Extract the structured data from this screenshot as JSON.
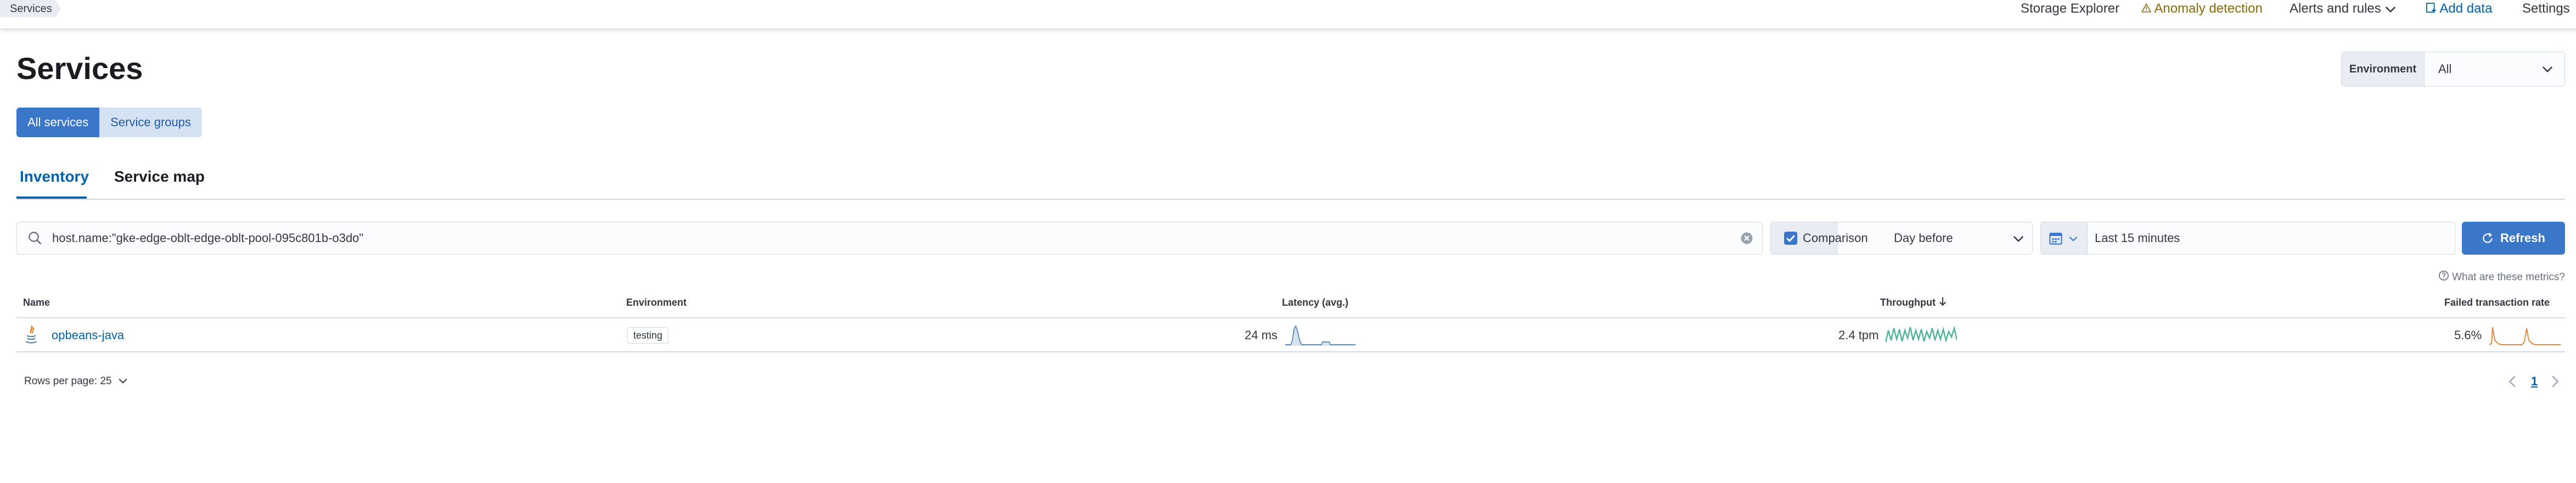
{
  "breadcrumb": {
    "current": "Services"
  },
  "topnav": {
    "storage_explorer": "Storage Explorer",
    "anomaly_detection": "Anomaly detection",
    "alerts_and_rules": "Alerts and rules",
    "add_data": "Add data",
    "settings": "Settings"
  },
  "page": {
    "title": "Services"
  },
  "service_group_toggle": {
    "all_services": "All services",
    "service_groups": "Service groups"
  },
  "environment": {
    "label": "Environment",
    "value": "All"
  },
  "tabs": [
    {
      "label": "Inventory",
      "active": true
    },
    {
      "label": "Service map",
      "active": false
    }
  ],
  "search": {
    "value": "host.name:\"gke-edge-oblt-edge-oblt-pool-095c801b-o3do\""
  },
  "comparison": {
    "label": "Comparison",
    "checked": true,
    "value": "Day before"
  },
  "date_picker": {
    "value": "Last 15 minutes"
  },
  "refresh": {
    "label": "Refresh"
  },
  "metrics_help": "What are these metrics?",
  "table": {
    "columns": {
      "name": "Name",
      "environment": "Environment",
      "latency": "Latency (avg.)",
      "throughput": "Throughput",
      "failed": "Failed transaction rate"
    },
    "rows": [
      {
        "name": "opbeans-java",
        "environment": "testing",
        "latency": "24 ms",
        "throughput": "2.4 tpm",
        "failed": "5.6%"
      }
    ]
  },
  "pagination": {
    "rows_per_page": "Rows per page: 25",
    "current_page": "1"
  },
  "colors": {
    "primary": "#3b77c9",
    "link": "#0061a6",
    "latency_spark": "#6092c0",
    "throughput_spark": "#54b399",
    "failed_spark": "#da8b45",
    "warning": "#8a6a0a"
  }
}
